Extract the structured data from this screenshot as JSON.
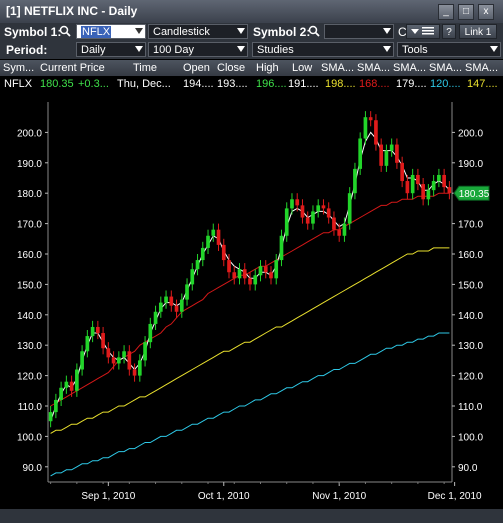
{
  "window": {
    "title": "[1] NETFLIX INC - Daily",
    "btn_min": "_",
    "btn_max": "□",
    "btn_close": "x"
  },
  "toolbar": {
    "symbol1_label": "Symbol 1:",
    "symbol1_value": "NFLX",
    "chart_type": "Candlestick",
    "symbol2_label": "Symbol 2:",
    "symbol2_value": "",
    "c_label": "C",
    "period_label": "Period:",
    "period_value": "Daily",
    "range_value": "100 Day",
    "studies_value": "Studies",
    "tools_value": "Tools",
    "help_label": "?",
    "link_label": "Link 1"
  },
  "table": {
    "headers": [
      "Sym...",
      "Current Price",
      "Time",
      "Open",
      "Close",
      "High",
      "Low",
      "SMA...",
      "SMA...",
      "SMA...",
      "SMA...",
      "SMA..."
    ],
    "row": {
      "sym": "NFLX",
      "price": "180.35",
      "change": "+0.3...",
      "time": "Thu, Dec...",
      "open": "194....",
      "close": "193....",
      "high": "196....",
      "low": "191....",
      "sma1": "198....",
      "sma2": "168....",
      "sma3": "179....",
      "sma4": "120....",
      "sma5": "147...."
    }
  },
  "colors": {
    "up": "#22d52a",
    "down": "#e01b1b",
    "sma_white": "#ffffff",
    "sma_red": "#d41818",
    "sma_yellow": "#e9e02e",
    "sma_cyan": "#2ec8e6",
    "price_tag": "#19a83a"
  },
  "axis": {
    "current_tag": "180.35",
    "x_labels": [
      "Sep 1, 2010",
      "Oct 1, 2010",
      "Nov 1, 2010",
      "Dec 1, 2010"
    ]
  },
  "chart_data": {
    "type": "candlestick",
    "ylim": [
      85,
      210
    ],
    "y_ticks": [
      90,
      100,
      110,
      120,
      130,
      140,
      150,
      160,
      170,
      180,
      190,
      200
    ],
    "x_ticks": [
      "Sep 1, 2010",
      "Oct 1, 2010",
      "Nov 1, 2010",
      "Dec 1, 2010"
    ],
    "closes": [
      108,
      112,
      116,
      118,
      115,
      122,
      128,
      133,
      136,
      134,
      129,
      126,
      124,
      126,
      128,
      122,
      120,
      125,
      131,
      137,
      141,
      144,
      146,
      143,
      141,
      145,
      150,
      155,
      158,
      162,
      166,
      168,
      163,
      158,
      154,
      152,
      155,
      152,
      150,
      153,
      156,
      154,
      152,
      158,
      166,
      175,
      178,
      176,
      172,
      170,
      174,
      176,
      175,
      172,
      168,
      166,
      170,
      180,
      188,
      198,
      205,
      204,
      196,
      189,
      194,
      196,
      190,
      184,
      180,
      186,
      183,
      178,
      181,
      184,
      186,
      182,
      180
    ],
    "sma_white": [
      105,
      110,
      114,
      117,
      116,
      119,
      125,
      130,
      134,
      134,
      131,
      128,
      126,
      125,
      126,
      124,
      122,
      124,
      128,
      134,
      138,
      142,
      144,
      144,
      143,
      144,
      148,
      152,
      156,
      160,
      163,
      166,
      165,
      161,
      158,
      156,
      155,
      154,
      152,
      152,
      154,
      154,
      153,
      156,
      162,
      169,
      174,
      175,
      174,
      172,
      173,
      174,
      174,
      173,
      171,
      169,
      170,
      176,
      183,
      191,
      197,
      200,
      198,
      194,
      194,
      194,
      192,
      189,
      185,
      185,
      184,
      181,
      181,
      183,
      184,
      183,
      181
    ],
    "sma_red": [
      110,
      111,
      112,
      113,
      114,
      115,
      116,
      117,
      118,
      119,
      120,
      121,
      123,
      125,
      126,
      127,
      128,
      130,
      131,
      132,
      133,
      134,
      136,
      137,
      139,
      141,
      142,
      143,
      144,
      145,
      147,
      148,
      149,
      150,
      151,
      152,
      153,
      153,
      154,
      155,
      156,
      156,
      157,
      158,
      159,
      160,
      161,
      162,
      163,
      164,
      165,
      166,
      167,
      167,
      168,
      168,
      169,
      170,
      171,
      172,
      173,
      174,
      175,
      176,
      176,
      177,
      177,
      178,
      178,
      178,
      179,
      179,
      179,
      179,
      180,
      180,
      180
    ],
    "sma_yellow": [
      101,
      102,
      102,
      103,
      104,
      104,
      105,
      106,
      106,
      107,
      108,
      108,
      109,
      110,
      110,
      111,
      112,
      113,
      113,
      114,
      115,
      116,
      117,
      118,
      119,
      120,
      121,
      122,
      123,
      124,
      125,
      126,
      127,
      128,
      128,
      129,
      130,
      131,
      131,
      132,
      133,
      134,
      135,
      136,
      136,
      137,
      138,
      139,
      140,
      141,
      142,
      143,
      144,
      145,
      146,
      147,
      148,
      149,
      150,
      151,
      152,
      153,
      154,
      155,
      156,
      157,
      158,
      159,
      160,
      160,
      161,
      161,
      161,
      162,
      162,
      162,
      162
    ],
    "sma_cyan": [
      87,
      88,
      88,
      89,
      89,
      90,
      91,
      91,
      92,
      92,
      93,
      93,
      94,
      95,
      95,
      96,
      96,
      97,
      98,
      98,
      99,
      100,
      100,
      101,
      102,
      102,
      103,
      104,
      104,
      105,
      106,
      106,
      107,
      108,
      108,
      109,
      110,
      110,
      111,
      112,
      112,
      113,
      114,
      114,
      115,
      116,
      116,
      117,
      118,
      118,
      119,
      120,
      120,
      121,
      122,
      122,
      123,
      124,
      124,
      125,
      126,
      127,
      127,
      128,
      129,
      129,
      130,
      130,
      131,
      131,
      132,
      132,
      133,
      133,
      134,
      134,
      134
    ]
  }
}
